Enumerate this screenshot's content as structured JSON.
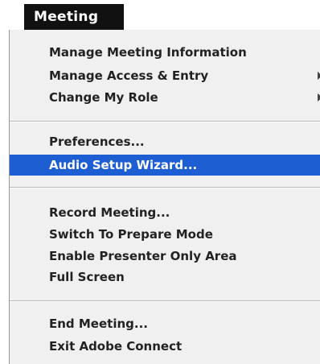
{
  "menu": {
    "title": "Meeting",
    "groups": [
      {
        "items": [
          {
            "label": "Manage Meeting Information"
          },
          {
            "label": "Manage Access & Entry"
          },
          {
            "label": "Change My Role"
          }
        ]
      },
      {
        "items": [
          {
            "label": "Preferences..."
          },
          {
            "label": "Audio Setup Wizard..."
          }
        ]
      },
      {
        "items": [
          {
            "label": "Record Meeting..."
          },
          {
            "label": "Switch To Prepare Mode"
          },
          {
            "label": "Enable Presenter Only Area"
          },
          {
            "label": "Full Screen"
          }
        ]
      },
      {
        "items": [
          {
            "label": "End Meeting..."
          },
          {
            "label": "Exit Adobe Connect"
          }
        ]
      }
    ],
    "highlight_color": "#1d5fd3"
  }
}
